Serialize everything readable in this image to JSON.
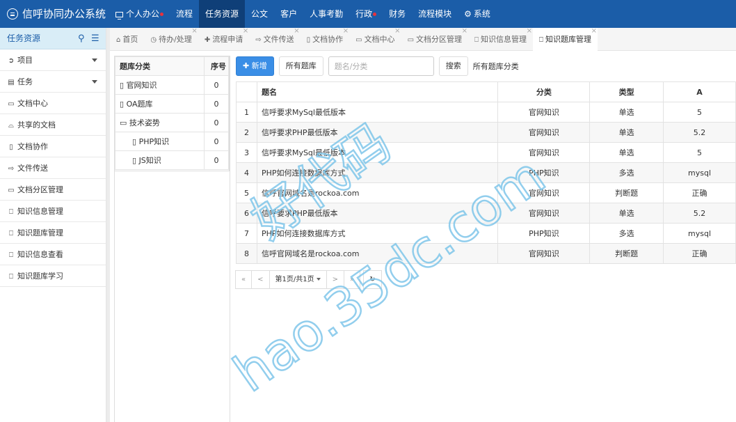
{
  "app": {
    "title": "信呼协同办公系统"
  },
  "nav": [
    {
      "label": "个人办公",
      "dot": true
    },
    {
      "label": "流程",
      "dot": false
    },
    {
      "label": "任务资源",
      "dot": false,
      "active": true
    },
    {
      "label": "公文",
      "dot": false
    },
    {
      "label": "客户",
      "dot": false
    },
    {
      "label": "人事考勤",
      "dot": false
    },
    {
      "label": "行政",
      "dot": true
    },
    {
      "label": "财务",
      "dot": false
    },
    {
      "label": "流程模块",
      "dot": false
    },
    {
      "label": "系统",
      "dot": false
    }
  ],
  "sidebar": {
    "title": "任务资源",
    "items": [
      {
        "label": "项目",
        "icon": "circle-arrow-icon",
        "caret": true
      },
      {
        "label": "任务",
        "icon": "book-icon",
        "caret": true
      },
      {
        "label": "文档中心",
        "icon": "folder-icon"
      },
      {
        "label": "共享的文档",
        "icon": "folder-open-icon"
      },
      {
        "label": "文档协作",
        "icon": "file-icon"
      },
      {
        "label": "文件传送",
        "icon": "share-icon"
      },
      {
        "label": "文档分区管理",
        "icon": "folder-icon"
      },
      {
        "label": "知识信息管理",
        "icon": "bookmark-icon"
      },
      {
        "label": "知识题库管理",
        "icon": "bookmark-icon"
      },
      {
        "label": "知识信息查看",
        "icon": "bookmark-icon"
      },
      {
        "label": "知识题库学习",
        "icon": "bookmark-icon"
      }
    ]
  },
  "tabs": [
    {
      "label": "首页",
      "icon": "home-icon",
      "closable": false
    },
    {
      "label": "待办/处理",
      "icon": "clock-icon",
      "closable": true
    },
    {
      "label": "流程申请",
      "icon": "plus-icon",
      "closable": true
    },
    {
      "label": "文件传送",
      "icon": "share-icon",
      "closable": true
    },
    {
      "label": "文档协作",
      "icon": "file-icon",
      "closable": true
    },
    {
      "label": "文档中心",
      "icon": "folder-icon",
      "closable": true
    },
    {
      "label": "文档分区管理",
      "icon": "folder-icon",
      "closable": true
    },
    {
      "label": "知识信息管理",
      "icon": "bookmark-icon",
      "closable": true
    },
    {
      "label": "知识题库管理",
      "icon": "bookmark-icon",
      "closable": true,
      "active": true
    }
  ],
  "categories": {
    "headers": [
      "题库分类",
      "序号"
    ],
    "rows": [
      {
        "name": "官网知识",
        "num": "0",
        "indent": false,
        "icon": "file-icon"
      },
      {
        "name": "OA题库",
        "num": "0",
        "indent": false,
        "icon": "file-icon"
      },
      {
        "name": "技术姿势",
        "num": "0",
        "indent": false,
        "icon": "folder-icon"
      },
      {
        "name": "PHP知识",
        "num": "0",
        "indent": true,
        "icon": "file-icon"
      },
      {
        "name": "JS知识",
        "num": "0",
        "indent": true,
        "icon": "file-icon"
      }
    ]
  },
  "toolbar": {
    "add_label": "新增",
    "all_label": "所有题库",
    "search_placeholder": "题名/分类",
    "search_label": "搜索",
    "crumb": "所有题库分类"
  },
  "grid": {
    "headers": [
      "",
      "题名",
      "分类",
      "类型",
      "A"
    ],
    "rows": [
      [
        "1",
        "信呼要求MySql最低版本",
        "官网知识",
        "单选",
        "5"
      ],
      [
        "2",
        "信呼要求PHP最低版本",
        "官网知识",
        "单选",
        "5.2"
      ],
      [
        "3",
        "信呼要求MySql最低版本",
        "官网知识",
        "单选",
        "5"
      ],
      [
        "4",
        "PHP如何连接数据库方式",
        "PHP知识",
        "多选",
        "mysql"
      ],
      [
        "5",
        "信呼官网域名是rockoa.com",
        "官网知识",
        "判断题",
        "正确"
      ],
      [
        "6",
        "信呼要求PHP最低版本",
        "官网知识",
        "单选",
        "5.2"
      ],
      [
        "7",
        "PHP如何连接数据库方式",
        "PHP知识",
        "多选",
        "mysql"
      ],
      [
        "8",
        "信呼官网域名是rockoa.com",
        "官网知识",
        "判断题",
        "正确"
      ]
    ]
  },
  "pager": {
    "first": "«",
    "prev": "<",
    "page": "第1页/共1页",
    "next": ">",
    "last": "»",
    "refresh_icon": "refresh-icon"
  },
  "watermark": {
    "line1": "好代码",
    "line2": "hao.35dc.com",
    "color": "#7fc6ea"
  },
  "colors": {
    "topbar": "#1b5da8",
    "active_nav": "#0f3f78",
    "primary": "#3a8ee6",
    "dot": "#e8323c"
  }
}
